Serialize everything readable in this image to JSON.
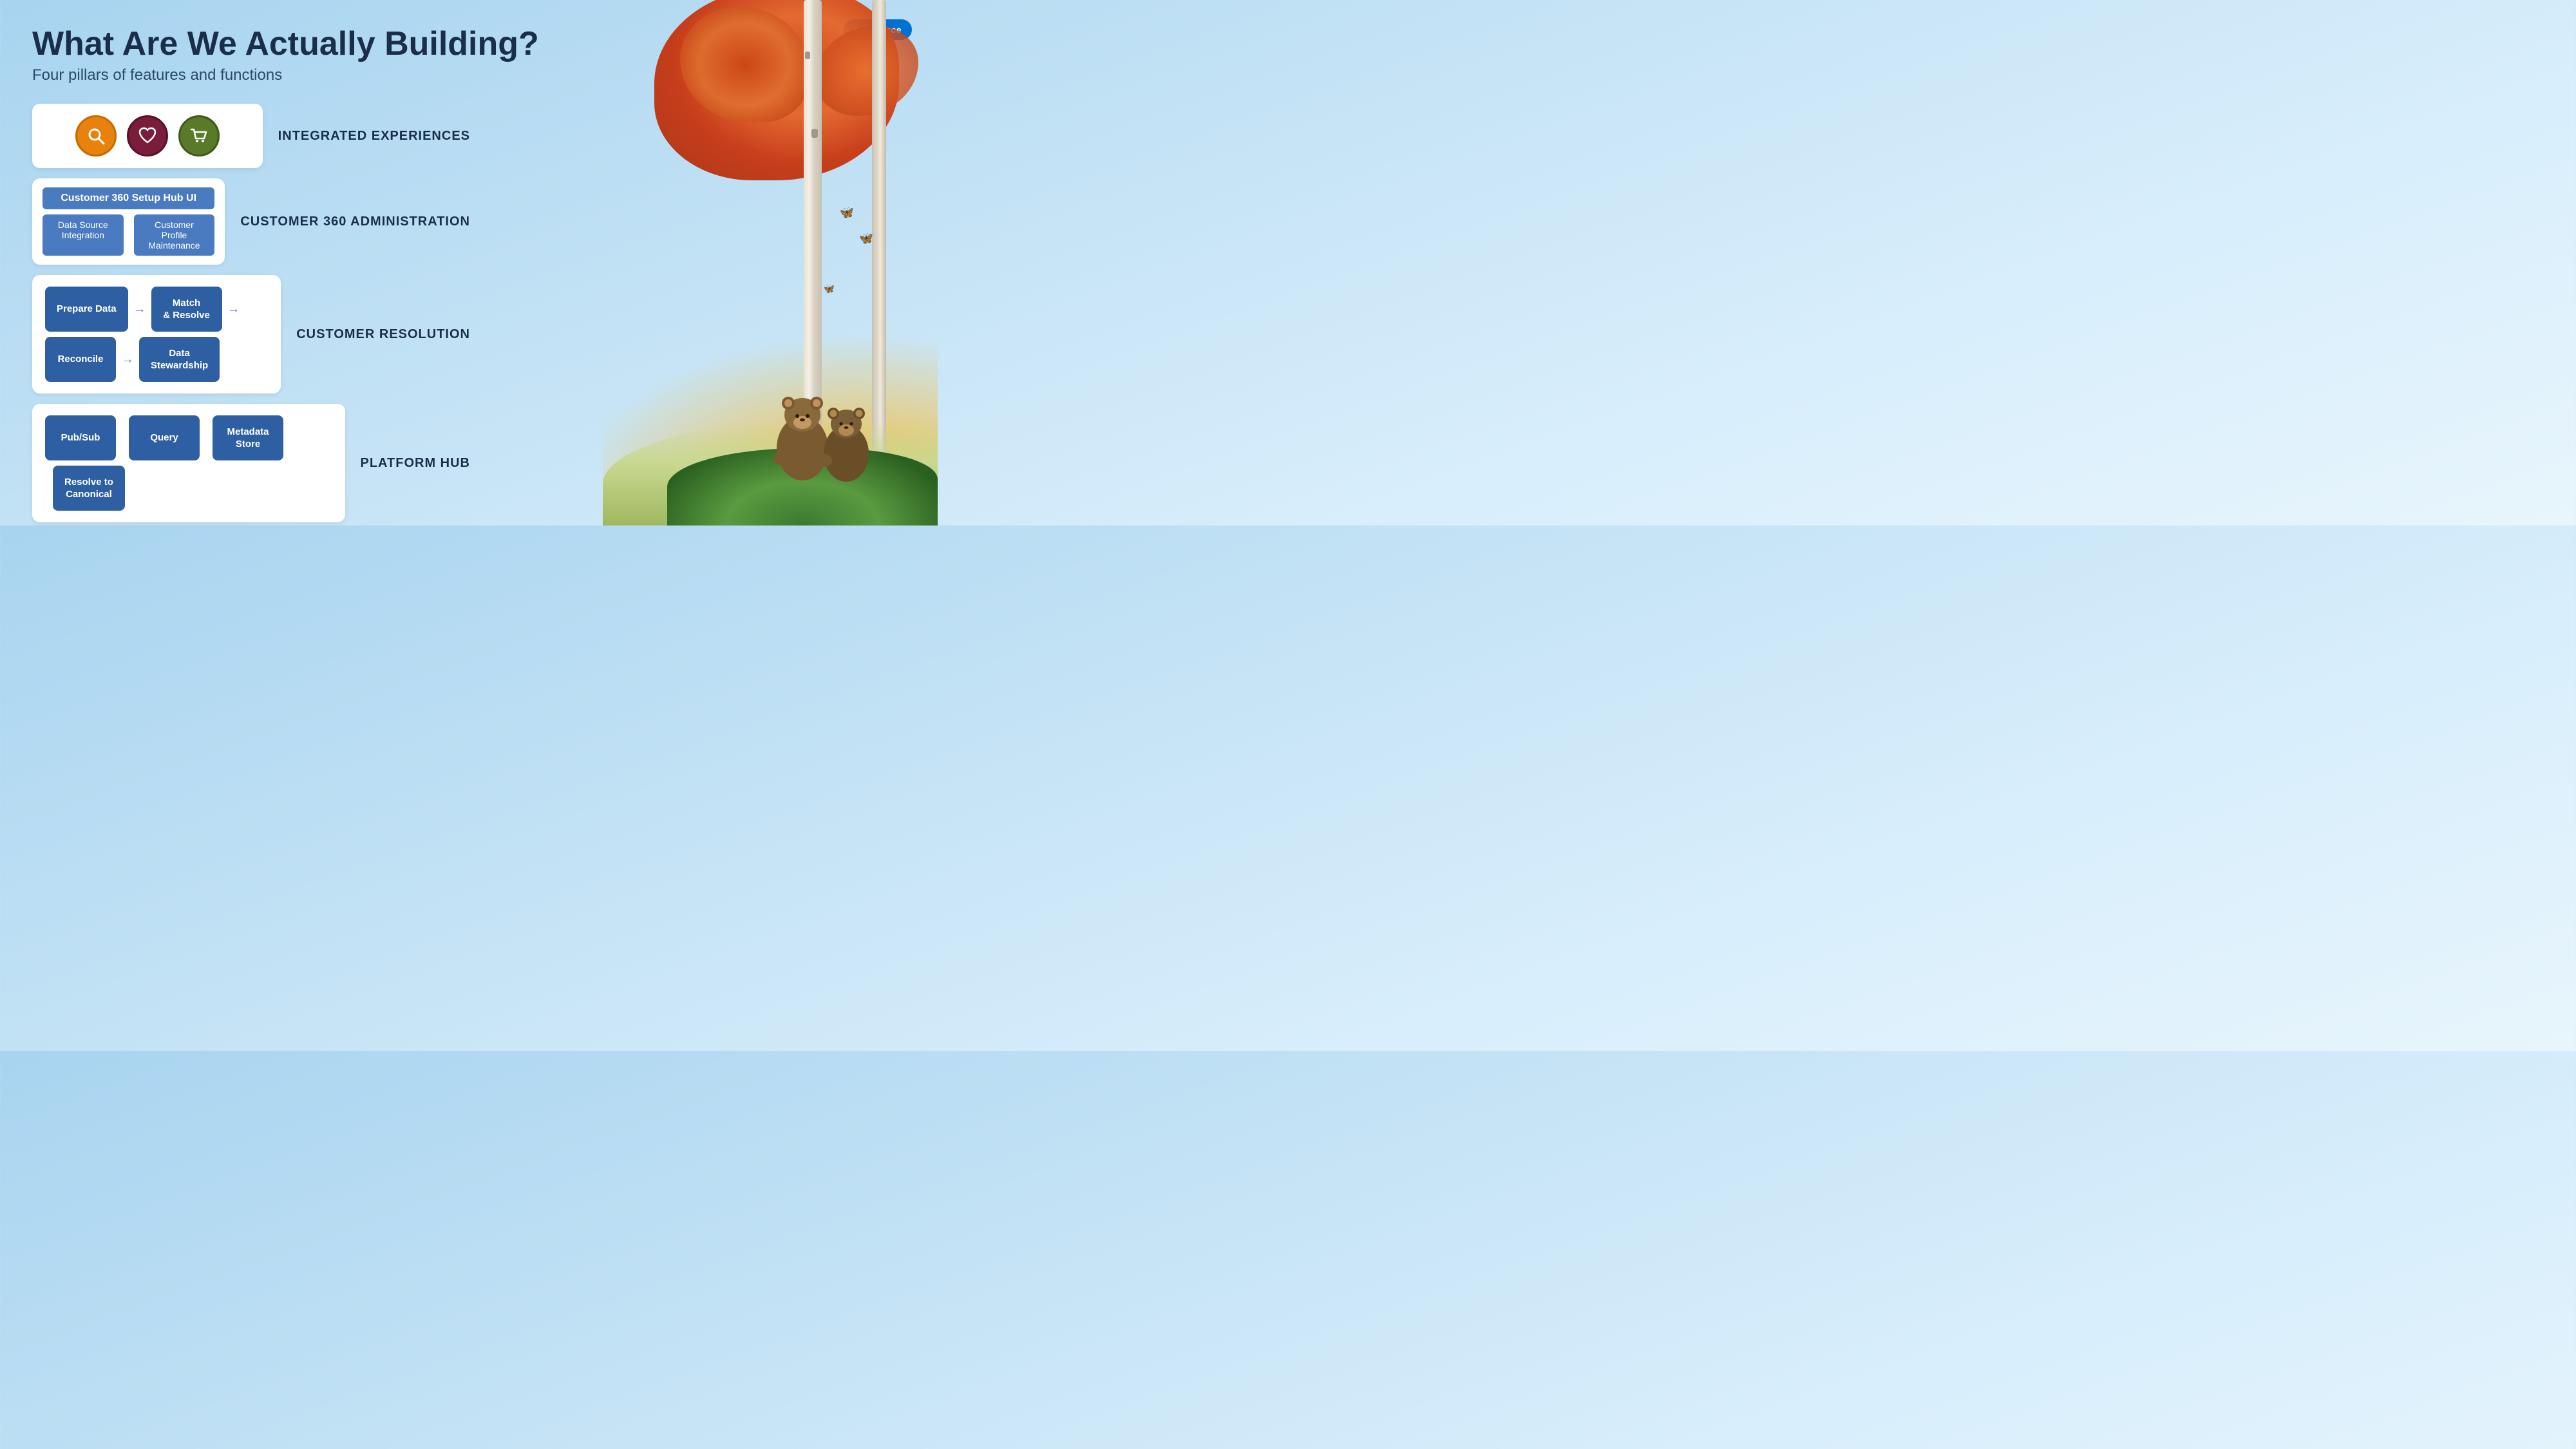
{
  "page": {
    "title": "What Are We Actually Building?",
    "subtitle": "Four pillars of features and functions"
  },
  "logo": {
    "label": "salesforce"
  },
  "pillars": [
    {
      "id": "integrated-experiences",
      "label": "INTEGRATED EXPERIENCES",
      "type": "icons",
      "icons": [
        {
          "id": "search-icon",
          "shape": "search",
          "color": "orange",
          "symbol": "🔍"
        },
        {
          "id": "heart-icon",
          "shape": "heart",
          "color": "maroon",
          "symbol": "♡"
        },
        {
          "id": "cart-icon",
          "shape": "cart",
          "color": "olive",
          "symbol": "🛒"
        }
      ]
    },
    {
      "id": "customer-360-admin",
      "label": "CUSTOMER 360 ADMINISTRATION",
      "type": "admin",
      "main_bar": "Customer 360 Setup Hub UI",
      "sub_bars": [
        "Data Source Integration",
        "Customer Profile Maintenance"
      ]
    },
    {
      "id": "customer-resolution",
      "label": "CUSTOMER RESOLUTION",
      "type": "steps",
      "steps": [
        {
          "id": "prepare-data",
          "label": "Prepare Data"
        },
        {
          "id": "match-resolve",
          "label": "Match\n& Resolve"
        },
        {
          "id": "reconcile",
          "label": "Reconcile"
        },
        {
          "id": "data-stewardship",
          "label": "Data\nStewardship"
        }
      ]
    },
    {
      "id": "platform-hub",
      "label": "PLATFORM HUB",
      "type": "steps",
      "steps": [
        {
          "id": "pub-sub",
          "label": "Pub/Sub"
        },
        {
          "id": "query",
          "label": "Query"
        },
        {
          "id": "metadata-store",
          "label": "Metadata\nStore"
        },
        {
          "id": "resolve-canonical",
          "label": "Resolve to\nCanonical"
        }
      ]
    }
  ],
  "arrow_symbol": "→",
  "colors": {
    "button_bg": "#2e5fa3",
    "admin_bar": "#4a7abf",
    "title": "#1a2e4a",
    "subtitle": "#2a4a6a",
    "label": "#1a2e4a",
    "sf_logo_bg": "#0070d2"
  }
}
